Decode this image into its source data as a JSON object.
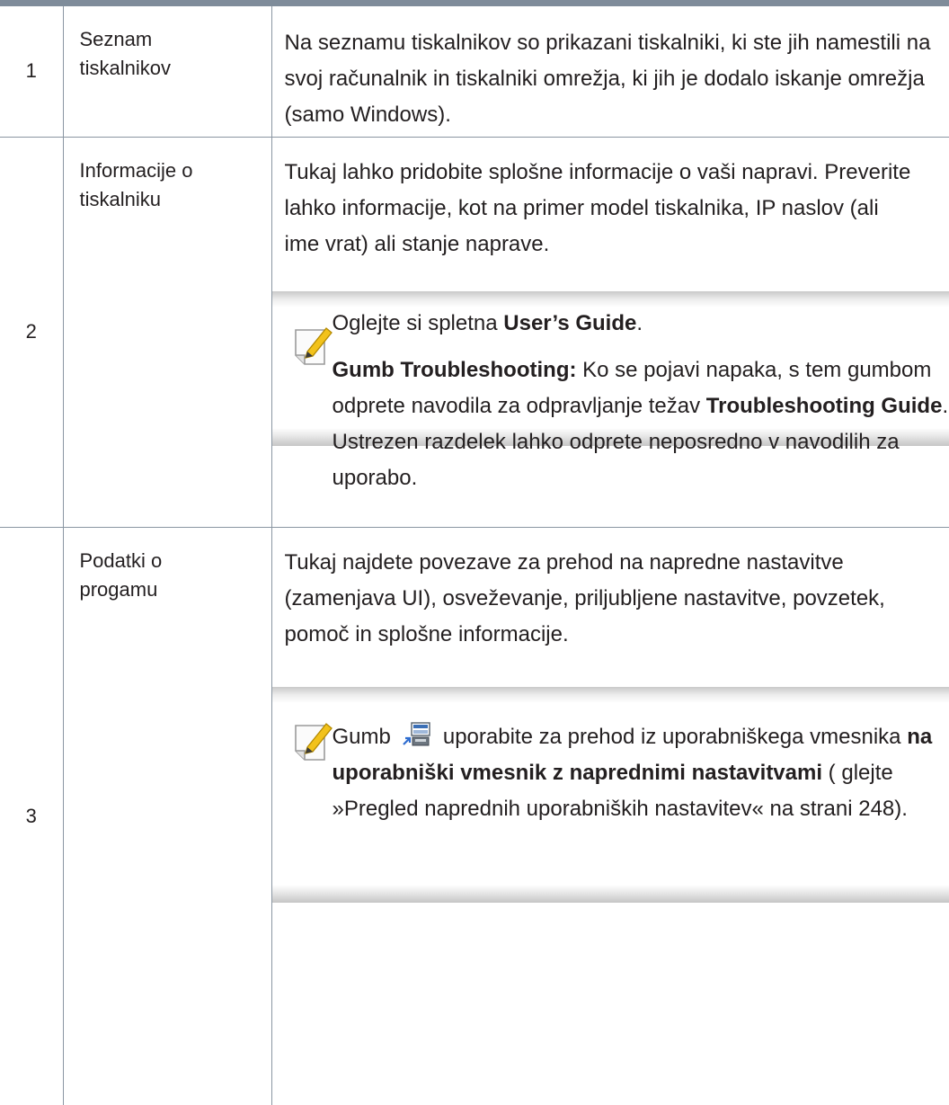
{
  "rows": [
    {
      "number": "1",
      "name_lines": [
        "Seznam",
        "tiskalnikov"
      ],
      "description": "Na seznamu tiskalnikov so prikazani tiskalniki, ki ste jih namestili na svoj računalnik in tiskalniki omrežja, ki jih je dodalo iskanje omrežja (samo Windows)."
    },
    {
      "number": "2",
      "name_lines": [
        "Informacije o",
        "tiskalniku"
      ],
      "description": "Tukaj lahko pridobite splošne informacije o vaši napravi. Preverite lahko informacije, kot na primer model tiskalnika, IP naslov (ali ime vrat) ali stanje naprave.",
      "note": {
        "p1_text": "Oglejte si spletna ",
        "p1_bold": "User’s Guide",
        "p1_end": ".",
        "p2_bold": "Gumb Troubleshooting:",
        "p2_text": " Ko se pojavi napaka, s tem gumbom odprete navodila za odpravljanje težav ",
        "p2_bold2": "Troubleshooting Guide",
        "p2_end": ". Ustrezen razdelek lahko odprete neposredno v navodilih za uporabo."
      }
    },
    {
      "number": "3",
      "name_lines": [
        "Podatki o",
        "progamu"
      ],
      "description": "Tukaj najdete povezave za prehod na napredne nastavitve (zamenjava UI), osveževanje, priljubljene nastavitve, povzetek, pomoč in splošne informacije.",
      "note": {
        "t1": "Gumb",
        "t2": "uporabite za prehod iz uporabniškega vmesnika ",
        "bold": "na uporabniški vmesnik z naprednimi nastavitvami",
        "t3": " ( glejte »Pregled naprednih uporabniških nastavitev« na strani 248).",
        "button_icon": "advanced-mode-switch-icon"
      }
    }
  ],
  "colors": {
    "rule": "#7f8c9a",
    "text": "#231f20",
    "note_shade": "#c9c9c9",
    "icon_pencil": "#f2c21b"
  }
}
